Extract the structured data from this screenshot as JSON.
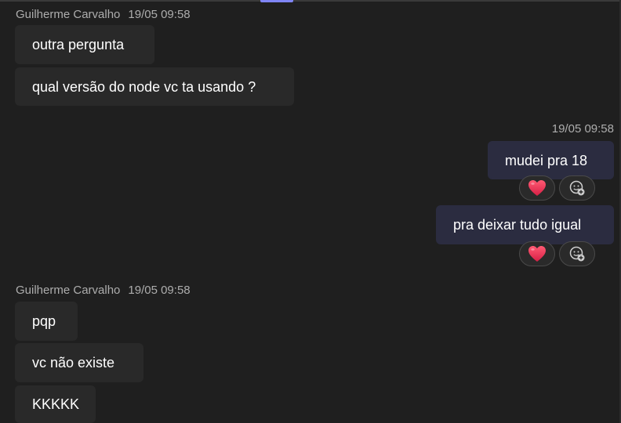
{
  "messages": {
    "group1": {
      "sender": "Guilherme Carvalho",
      "time": "19/05 09:58",
      "bubbles": [
        "outra pergunta",
        "qual versão do node vc ta usando ?"
      ]
    },
    "group2": {
      "time": "19/05 09:58",
      "bubbles": [
        "mudei pra 18",
        "pra deixar tudo igual"
      ],
      "reaction_icons": [
        "heart-reaction-icon",
        "add-reaction-icon"
      ]
    },
    "group3": {
      "sender": "Guilherme Carvalho",
      "time": "19/05 09:58",
      "bubbles": [
        "pqp",
        "vc não existe",
        "KKKKK"
      ]
    }
  },
  "colors": {
    "background": "#1f1f1f",
    "incoming_bubble": "#292929",
    "outgoing_bubble": "#2b2c40",
    "meta_text": "#adadad",
    "accent": "#7f85f5",
    "heart": "#e8364f"
  }
}
